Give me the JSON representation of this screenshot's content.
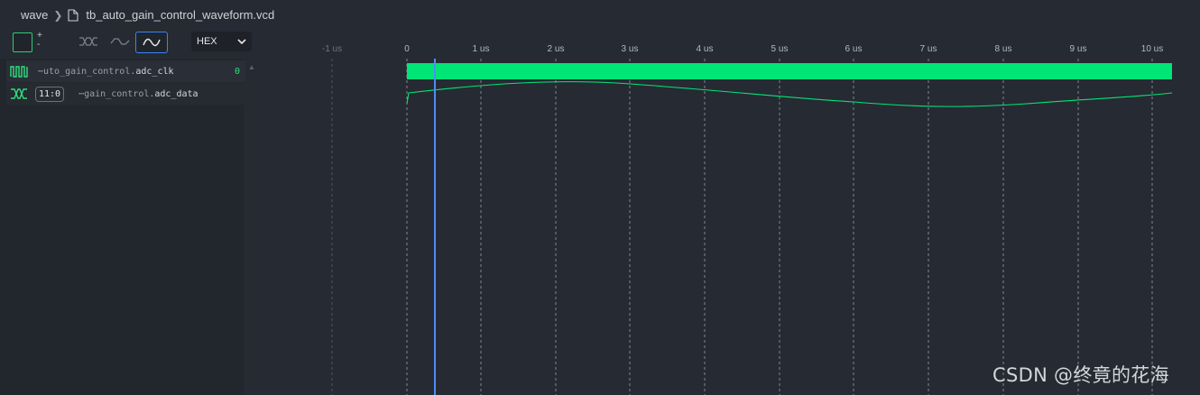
{
  "breadcrumb": {
    "root": "wave",
    "file": "tb_auto_gain_control_waveform.vcd"
  },
  "toolbar": {
    "plus": "+",
    "minus": "-",
    "radix_select": "HEX",
    "modes": [
      {
        "icon": "bus-icon",
        "active": false
      },
      {
        "icon": "digital-wave-icon",
        "active": false
      },
      {
        "icon": "analog-wave-icon",
        "active": true
      }
    ]
  },
  "timeline": {
    "ticks": [
      "-1 us",
      "0",
      "1 us",
      "2 us",
      "3 us",
      "4 us",
      "5 us",
      "6 us",
      "7 us",
      "8 us",
      "9 us",
      "10 us"
    ],
    "cursor_time_us": 0.4
  },
  "signals": [
    {
      "prefix": "⋯uto_gain_control.",
      "name": "adc_clk",
      "value": "0",
      "icon": "clock-signal-icon"
    },
    {
      "prefix": "⋯gain_control.",
      "name": "adc_data",
      "width": "11:0",
      "icon": "bus-signal-icon"
    }
  ],
  "colors": {
    "signal_green": "#00e676",
    "cursor_blue": "#4f8cf7",
    "background": "#262a33"
  },
  "watermark": "CSDN @终竟的花海"
}
